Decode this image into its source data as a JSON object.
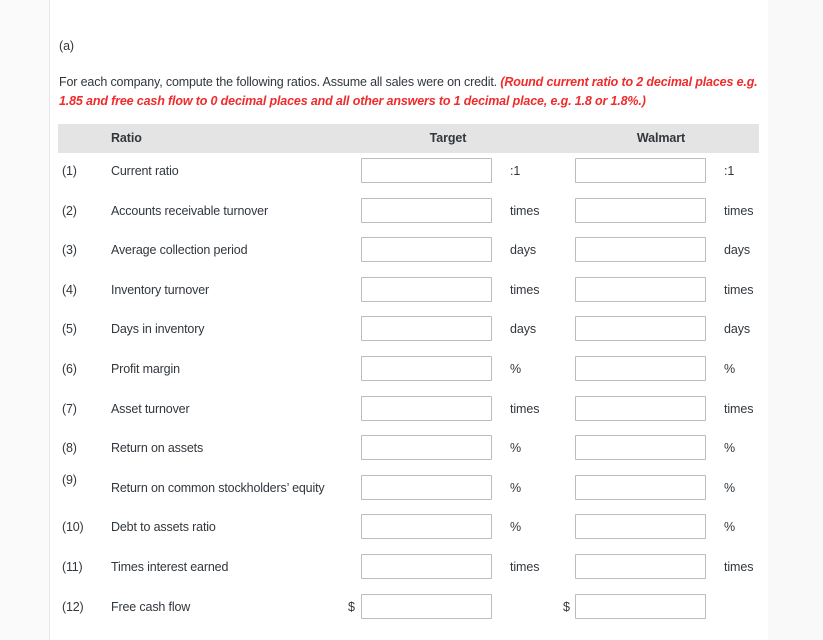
{
  "part_label": "(a)",
  "instructions": {
    "plain_lead": "For each company, compute the following ratios. Assume all sales were on credit. ",
    "emphasis": "(Round current ratio to 2 decimal places e.g. 1.85 and free cash flow to 0 decimal places and all other answers to 1 decimal place, e.g. 1.8 or 1.8%.)"
  },
  "table": {
    "headers": {
      "ratio": "Ratio",
      "target": "Target",
      "walmart": "Walmart"
    },
    "rows": [
      {
        "num": "(1)",
        "label": "Current ratio",
        "target_prefix": "",
        "target_value": "",
        "target_unit": ":1",
        "walmart_prefix": "",
        "walmart_value": "",
        "walmart_unit": ":1"
      },
      {
        "num": "(2)",
        "label": "Accounts receivable turnover",
        "target_prefix": "",
        "target_value": "",
        "target_unit": "times",
        "walmart_prefix": "",
        "walmart_value": "",
        "walmart_unit": "times"
      },
      {
        "num": "(3)",
        "label": "Average collection period",
        "target_prefix": "",
        "target_value": "",
        "target_unit": "days",
        "walmart_prefix": "",
        "walmart_value": "",
        "walmart_unit": "days"
      },
      {
        "num": "(4)",
        "label": "Inventory turnover",
        "target_prefix": "",
        "target_value": "",
        "target_unit": "times",
        "walmart_prefix": "",
        "walmart_value": "",
        "walmart_unit": "times"
      },
      {
        "num": "(5)",
        "label": "Days in inventory",
        "target_prefix": "",
        "target_value": "",
        "target_unit": "days",
        "walmart_prefix": "",
        "walmart_value": "",
        "walmart_unit": "days"
      },
      {
        "num": "(6)",
        "label": "Profit margin",
        "target_prefix": "",
        "target_value": "",
        "target_unit": "%",
        "walmart_prefix": "",
        "walmart_value": "",
        "walmart_unit": "%"
      },
      {
        "num": "(7)",
        "label": "Asset turnover",
        "target_prefix": "",
        "target_value": "",
        "target_unit": "times",
        "walmart_prefix": "",
        "walmart_value": "",
        "walmart_unit": "times"
      },
      {
        "num": "(8)",
        "label": "Return on assets",
        "target_prefix": "",
        "target_value": "",
        "target_unit": "%",
        "walmart_prefix": "",
        "walmart_value": "",
        "walmart_unit": "%"
      },
      {
        "num": "(9)",
        "label": "Return on common stockholders’ equity",
        "target_prefix": "",
        "target_value": "",
        "target_unit": "%",
        "walmart_prefix": "",
        "walmart_value": "",
        "walmart_unit": "%",
        "num_raised": true
      },
      {
        "num": "(10)",
        "label": "Debt to assets ratio",
        "target_prefix": "",
        "target_value": "",
        "target_unit": "%",
        "walmart_prefix": "",
        "walmart_value": "",
        "walmart_unit": "%"
      },
      {
        "num": "(11)",
        "label": "Times interest earned",
        "target_prefix": "",
        "target_value": "",
        "target_unit": "times",
        "walmart_prefix": "",
        "walmart_value": "",
        "walmart_unit": "times"
      },
      {
        "num": "(12)",
        "label": "Free cash flow",
        "target_prefix": "$",
        "target_value": "",
        "target_unit": "",
        "walmart_prefix": "$",
        "walmart_value": "",
        "walmart_unit": ""
      }
    ]
  },
  "colors": {
    "text": "#31373d",
    "emphasis": "#ef2b2b",
    "header_band": "#e4e4e4",
    "input_border": "#bcbcbc"
  }
}
